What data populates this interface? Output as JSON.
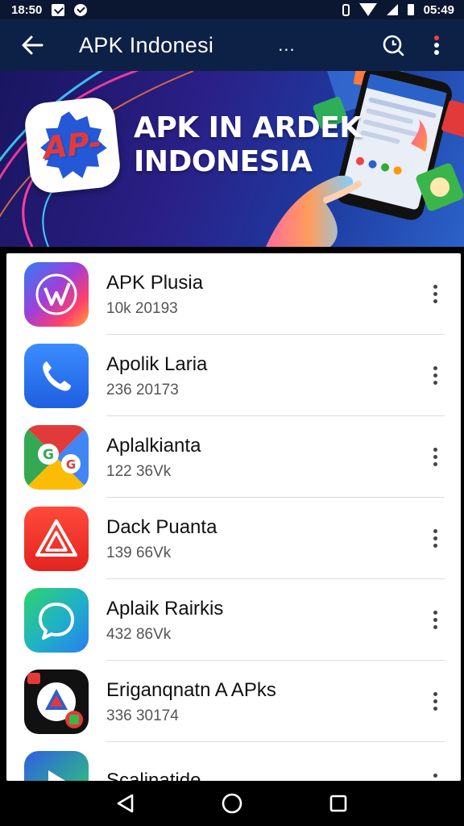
{
  "status_bar": {
    "time": "18:50",
    "clock": "05:49"
  },
  "app_bar": {
    "title": "APK Indonesi",
    "title_suffix": "..."
  },
  "banner": {
    "logo_text": "AP-",
    "title_line1": "APK IN ARDEK",
    "title_line2": "INDONESIA"
  },
  "apps": [
    {
      "name": "APK Plusia",
      "meta": "10k 20193",
      "icon": "stylized-w-icon"
    },
    {
      "name": "Apolik Laria",
      "meta": "236 20173",
      "icon": "phone-handset-icon"
    },
    {
      "name": "Aplalkianta",
      "meta": "122 36Vk",
      "icon": "g-logo-icon"
    },
    {
      "name": "Dack Puanta",
      "meta": "139 66Vk",
      "icon": "triangle-a-icon"
    },
    {
      "name": "Aplaik Rairkis",
      "meta": "432 86Vk",
      "icon": "chat-bubble-icon"
    },
    {
      "name": "Eriganqnatn A APks",
      "meta": "336 30174",
      "icon": "circle-triangle-icon"
    },
    {
      "name": "Scalinatide",
      "meta": "",
      "icon": "play-arrow-icon"
    }
  ],
  "colors": {
    "app_bar": "#0d2147",
    "status_bar": "#0b1630",
    "list_background": "#ffffff"
  }
}
